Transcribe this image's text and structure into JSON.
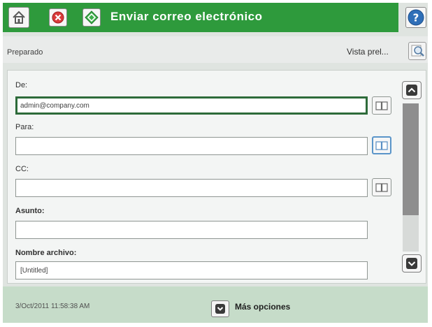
{
  "header": {
    "title": "Enviar correo electrónico",
    "accent_color": "#2e9a3c",
    "icons": [
      "home-icon",
      "stop-icon",
      "start-icon",
      "help-icon"
    ]
  },
  "status": {
    "text": "Preparado",
    "preview_label": "Vista prel...",
    "preview_icon": "magnifier-icon"
  },
  "form": {
    "from_label": "De:",
    "from_value": "admin@company.com",
    "to_label": "Para:",
    "to_value": "",
    "cc_label": "CC:",
    "cc_value": "",
    "subject_label": "Asunto:",
    "subject_value": "",
    "filename_label": "Nombre archivo:",
    "filename_value": "[Untitled]",
    "address_book_icon": "address-book-icon"
  },
  "footer": {
    "timestamp": "3/Oct/2011 11:58:38 AM",
    "more_options_label": "Más opciones"
  }
}
